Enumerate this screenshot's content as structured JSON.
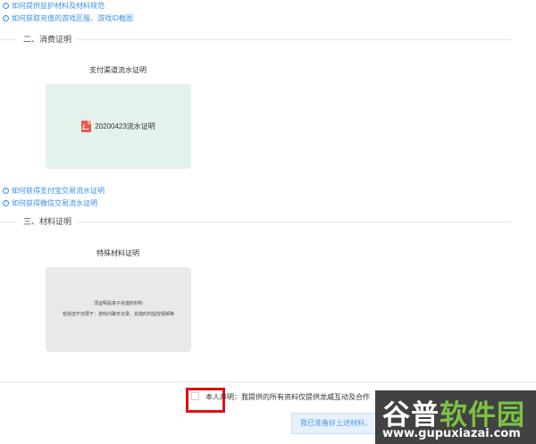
{
  "help_links_top": [
    {
      "label": "如何提供监护材料及材料规范"
    },
    {
      "label": "如何获取充值的游戏区服、游戏ID截图"
    }
  ],
  "section2": {
    "title": "二、消费证明",
    "card_label": "支付渠道流水证明",
    "file_name": "20200423流水证明",
    "help_links": [
      {
        "label": "如何获得支付宝交易流水证明"
      },
      {
        "label": "如何获得微信交易流水证明"
      }
    ]
  },
  "section3": {
    "title": "三、材料证明",
    "card_label": "特殊材料证明",
    "hint_lines": [
      "须证明是孩子充值的材料",
      "包括但不仅限于：游戏内聊天记录、充值时的监控视频等"
    ]
  },
  "declaration": {
    "text": "本人声明：我提供的所有资料仅提供龙威互动及合作",
    "checked": false
  },
  "ready_button": {
    "label": "我已准备好上述材料，"
  },
  "watermark": {
    "title_white": "谷普",
    "title_green": "软件园",
    "url": "www.gupuxiazai.com"
  },
  "colors": {
    "link": "#3a8ee6",
    "green_card": "#e3f2ea",
    "gray_card": "#eae8e8",
    "highlight": "#e01010",
    "pdf": "#e85a4f"
  },
  "icons": {
    "info": "info-circle-icon",
    "file": "pdf-file-icon"
  }
}
